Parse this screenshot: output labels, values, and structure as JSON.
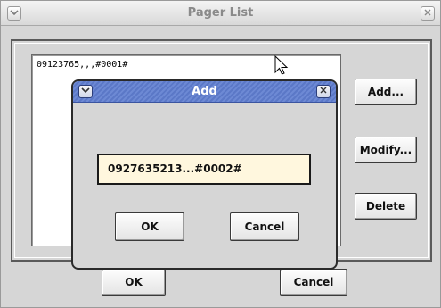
{
  "main_window": {
    "title": "Pager List",
    "list_items": [
      "09123765,,,#0001#"
    ],
    "buttons": {
      "add": "Add...",
      "modify": "Modify...",
      "delete": "Delete",
      "ok": "OK",
      "cancel": "Cancel"
    }
  },
  "dialog": {
    "title": "Add",
    "field_value": "0927635213...#0002#",
    "buttons": {
      "ok": "OK",
      "cancel": "Cancel"
    }
  },
  "icons": {
    "menu": "chevron-down-icon",
    "close": "close-icon",
    "pointer": "mouse-pointer-icon"
  }
}
